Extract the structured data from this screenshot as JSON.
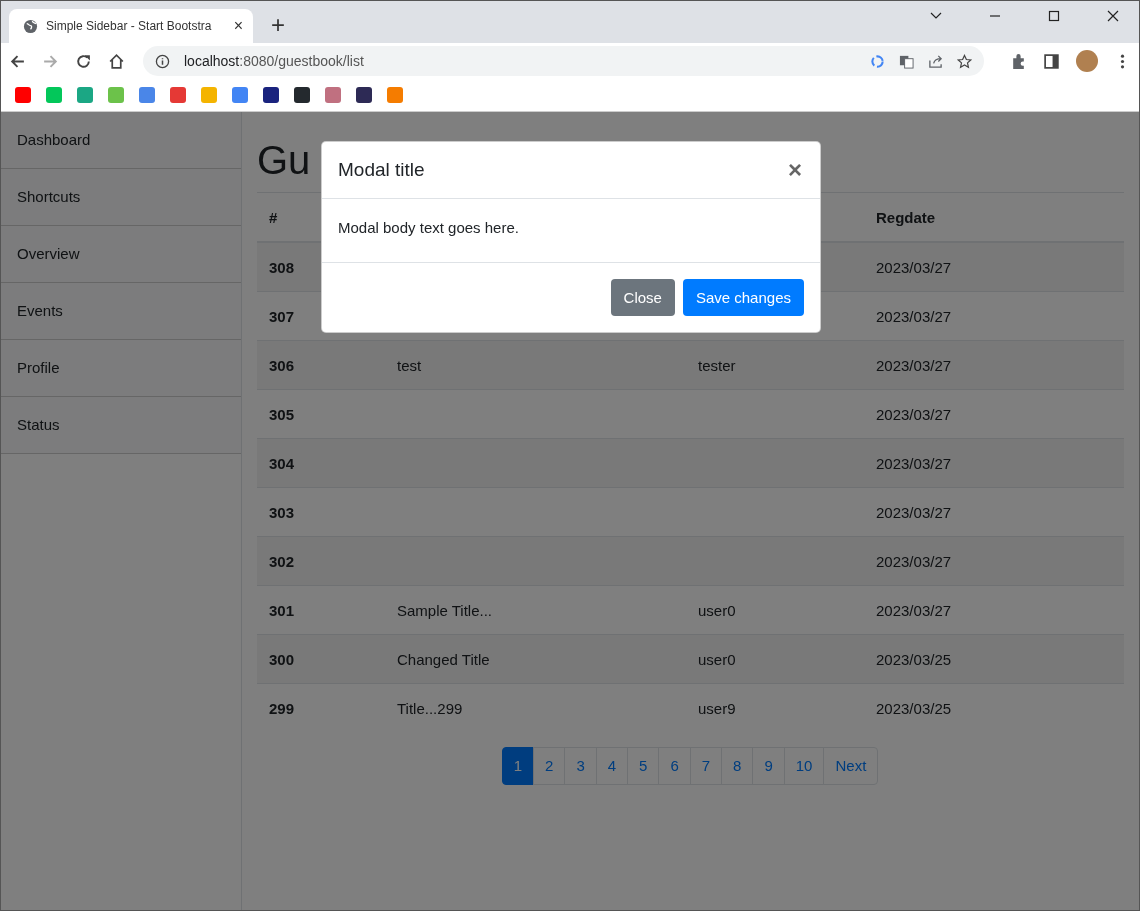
{
  "browser": {
    "tab": {
      "title": "Simple Sidebar - Start Bootstra",
      "close": "×",
      "selected": true
    },
    "new_tab": "+",
    "address": {
      "host": "localhost",
      "path": ":8080/guestbook/list"
    },
    "bookmarks": [
      {
        "color": "#ff0000"
      },
      {
        "color": "#03c75a"
      },
      {
        "color": "#1ba784"
      },
      {
        "color": "#6cc24a"
      },
      {
        "color": "#4a86e8"
      },
      {
        "color": "#e53935"
      },
      {
        "color": "#f4b400"
      },
      {
        "color": "#4285f4"
      },
      {
        "color": "#1a237e"
      },
      {
        "color": "#24292e"
      },
      {
        "color": "#c07080"
      },
      {
        "color": "#2d2a55"
      },
      {
        "color": "#f57c00"
      }
    ]
  },
  "sidebar": {
    "items": [
      {
        "label": "Dashboard"
      },
      {
        "label": "Shortcuts"
      },
      {
        "label": "Overview"
      },
      {
        "label": "Events"
      },
      {
        "label": "Profile"
      },
      {
        "label": "Status"
      }
    ]
  },
  "heading": "Gu",
  "table": {
    "columns": [
      "#",
      "",
      "",
      "Regdate"
    ],
    "rows": [
      {
        "number": "308",
        "title": "",
        "writer": "",
        "regdate": "2023/03/27"
      },
      {
        "number": "307",
        "title": "",
        "writer": "",
        "regdate": "2023/03/27"
      },
      {
        "number": "306",
        "title": "test",
        "writer": "tester",
        "regdate": "2023/03/27"
      },
      {
        "number": "305",
        "title": "",
        "writer": "",
        "regdate": "2023/03/27"
      },
      {
        "number": "304",
        "title": "",
        "writer": "",
        "regdate": "2023/03/27"
      },
      {
        "number": "303",
        "title": "",
        "writer": "",
        "regdate": "2023/03/27"
      },
      {
        "number": "302",
        "title": "",
        "writer": "",
        "regdate": "2023/03/27"
      },
      {
        "number": "301",
        "title": "Sample Title...",
        "writer": "user0",
        "regdate": "2023/03/27"
      },
      {
        "number": "300",
        "title": "Changed Title",
        "writer": "user0",
        "regdate": "2023/03/25"
      },
      {
        "number": "299",
        "title": "Title...299",
        "writer": "user9",
        "regdate": "2023/03/25"
      }
    ]
  },
  "pagination": [
    {
      "label": "1",
      "selected": true
    },
    {
      "label": "2",
      "selected": false
    },
    {
      "label": "3",
      "selected": false
    },
    {
      "label": "4",
      "selected": false
    },
    {
      "label": "5",
      "selected": false
    },
    {
      "label": "6",
      "selected": false
    },
    {
      "label": "7",
      "selected": false
    },
    {
      "label": "8",
      "selected": false
    },
    {
      "label": "9",
      "selected": false
    },
    {
      "label": "10",
      "selected": false
    },
    {
      "label": "Next",
      "selected": false
    }
  ],
  "modal": {
    "title": "Modal title",
    "close": "×",
    "body": "Modal body text goes here.",
    "buttons": [
      {
        "label": "Close",
        "kind": "secondary"
      },
      {
        "label": "Save changes",
        "kind": "primary"
      }
    ]
  }
}
